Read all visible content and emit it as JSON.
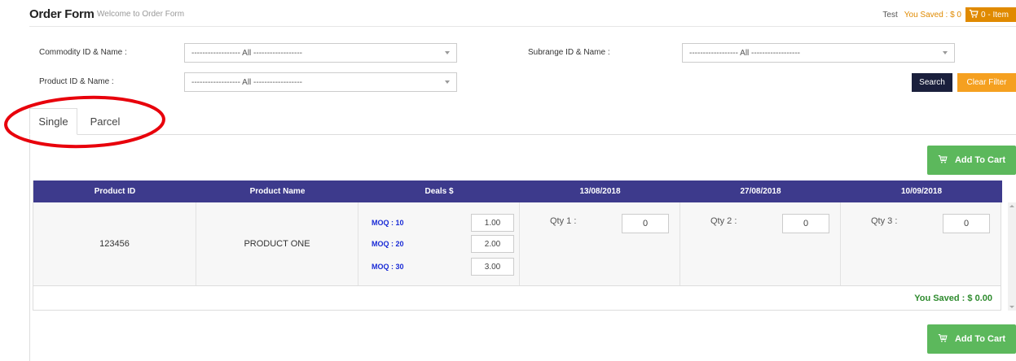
{
  "header": {
    "title": "Order Form",
    "subtitle": "Welcome to Order Form",
    "user": "Test",
    "saved": "You Saved : $ 0",
    "cart": "0 - Item"
  },
  "filters": {
    "commodity_label": "Commodity ID & Name :",
    "commodity_value": "------------------ All ------------------",
    "subrange_label": "Subrange ID & Name :",
    "subrange_value": "------------------ All ------------------",
    "product_label": "Product ID & Name :",
    "product_value": "------------------ All ------------------",
    "search": "Search",
    "clear": "Clear Filter"
  },
  "tabs": [
    {
      "label": "Single",
      "active": true
    },
    {
      "label": "Parcel",
      "active": false
    }
  ],
  "add_to_cart": "Add To Cart",
  "table": {
    "headers": [
      "Product ID",
      "Product Name",
      "Deals $",
      "13/08/2018",
      "27/08/2018",
      "10/09/2018"
    ],
    "row": {
      "product_id": "123456",
      "product_name": "PRODUCT ONE",
      "deals": [
        {
          "moq": "MOQ : 10",
          "price": "1.00"
        },
        {
          "moq": "MOQ : 20",
          "price": "2.00"
        },
        {
          "moq": "MOQ : 30",
          "price": "3.00"
        }
      ],
      "qty": [
        {
          "label": "Qty 1 :",
          "value": "0"
        },
        {
          "label": "Qty 2 :",
          "value": "0"
        },
        {
          "label": "Qty 3 :",
          "value": "0"
        }
      ]
    },
    "saved": "You Saved : $ 0.00"
  },
  "colors": {
    "header_bg": "#3d3a8c",
    "cart_green": "#5cb85c",
    "orange": "#e08a00",
    "search_dark": "#1a1f3c",
    "highlight_red": "#e8000b"
  }
}
